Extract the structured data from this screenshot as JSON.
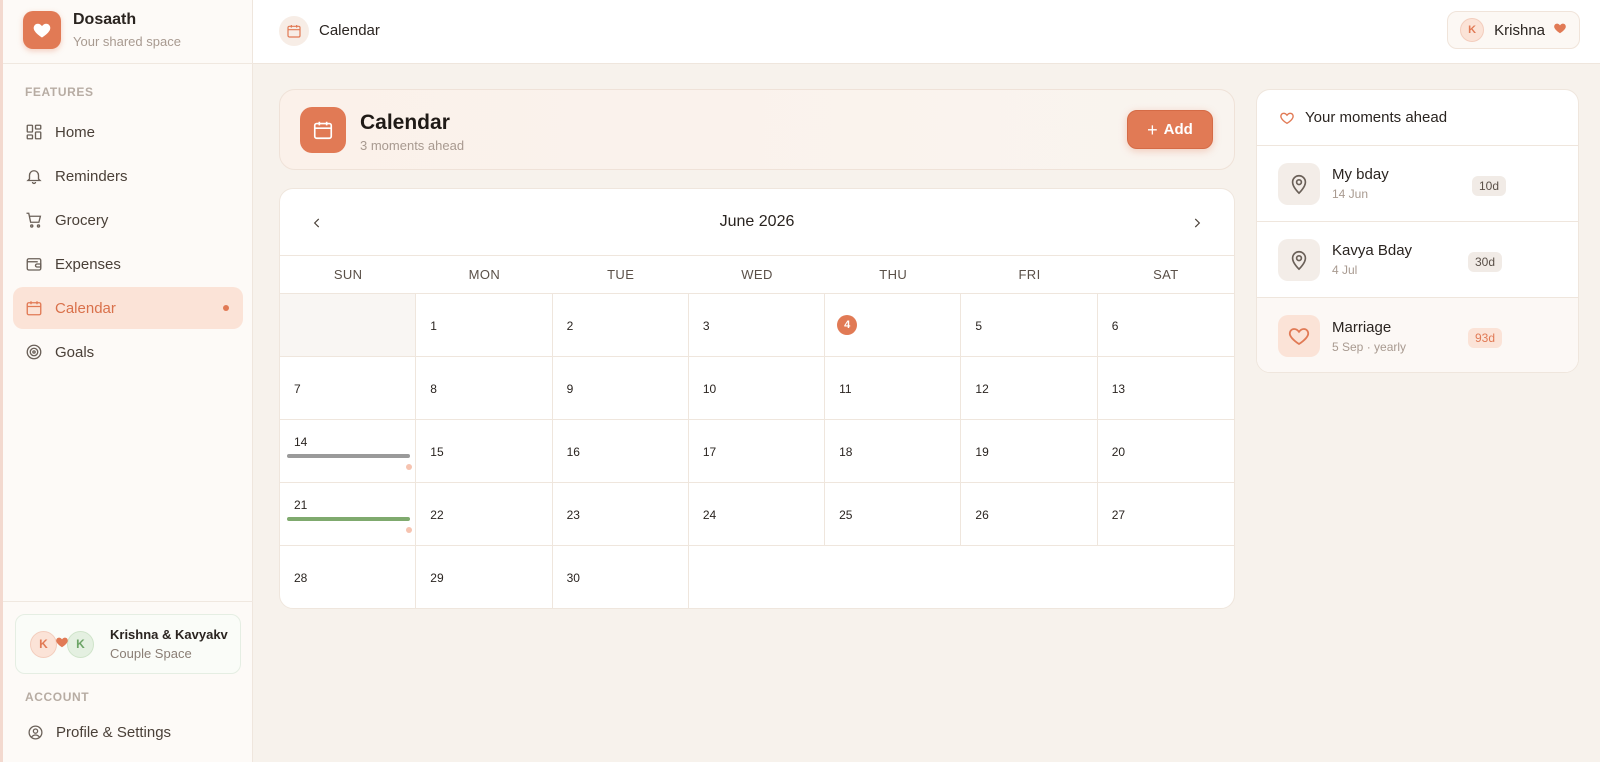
{
  "brand": {
    "name": "Dosaath",
    "subtitle": "Your shared space"
  },
  "sidebar": {
    "features_label": "FEATURES",
    "items": [
      {
        "label": "Home",
        "icon": "grid-icon"
      },
      {
        "label": "Reminders",
        "icon": "bell-icon"
      },
      {
        "label": "Grocery",
        "icon": "cart-icon"
      },
      {
        "label": "Expenses",
        "icon": "wallet-icon"
      },
      {
        "label": "Calendar",
        "icon": "calendar-icon",
        "active": true
      },
      {
        "label": "Goals",
        "icon": "target-icon"
      }
    ],
    "couple": {
      "initial1": "K",
      "initial2": "K",
      "name": "Krishna & Kavyakv",
      "subtitle": "Couple Space"
    },
    "account_label": "ACCOUNT",
    "profile_label": "Profile & Settings"
  },
  "topbar": {
    "title": "Calendar",
    "user_initial": "K",
    "user_name": "Krishna"
  },
  "header": {
    "title": "Calendar",
    "subtitle": "3 moments ahead",
    "add_label": "Add"
  },
  "calendar": {
    "month_label": "June 2026",
    "weekdays": [
      "SUN",
      "MON",
      "TUE",
      "WED",
      "THU",
      "FRI",
      "SAT"
    ],
    "weeks": [
      [
        "",
        "1",
        "2",
        "3",
        "4",
        "5",
        "6"
      ],
      [
        "7",
        "8",
        "9",
        "10",
        "11",
        "12",
        "13"
      ],
      [
        "14",
        "15",
        "16",
        "17",
        "18",
        "19",
        "20"
      ],
      [
        "21",
        "22",
        "23",
        "24",
        "25",
        "26",
        "27"
      ],
      [
        "28",
        "29",
        "30",
        "",
        "",
        "",
        ""
      ]
    ],
    "today": "4",
    "event_days": [
      {
        "day": "14",
        "color": "#9a9a9a"
      },
      {
        "day": "21",
        "color": "#7faa6e"
      }
    ]
  },
  "moments": {
    "title": "Your moments ahead",
    "items": [
      {
        "title": "My bday",
        "date": "14 Jun",
        "badge": "10d",
        "icon": "location-pin-icon"
      },
      {
        "title": "Kavya Bday",
        "date": "4 Jul",
        "badge": "30d",
        "icon": "location-pin-icon"
      },
      {
        "title": "Marriage",
        "date": "5 Sep · yearly",
        "badge": "93d",
        "icon": "heart-icon"
      }
    ]
  },
  "colors": {
    "accent": "#e17a55",
    "accent_soft": "#fbe3d7",
    "green": "#7faa6e"
  }
}
